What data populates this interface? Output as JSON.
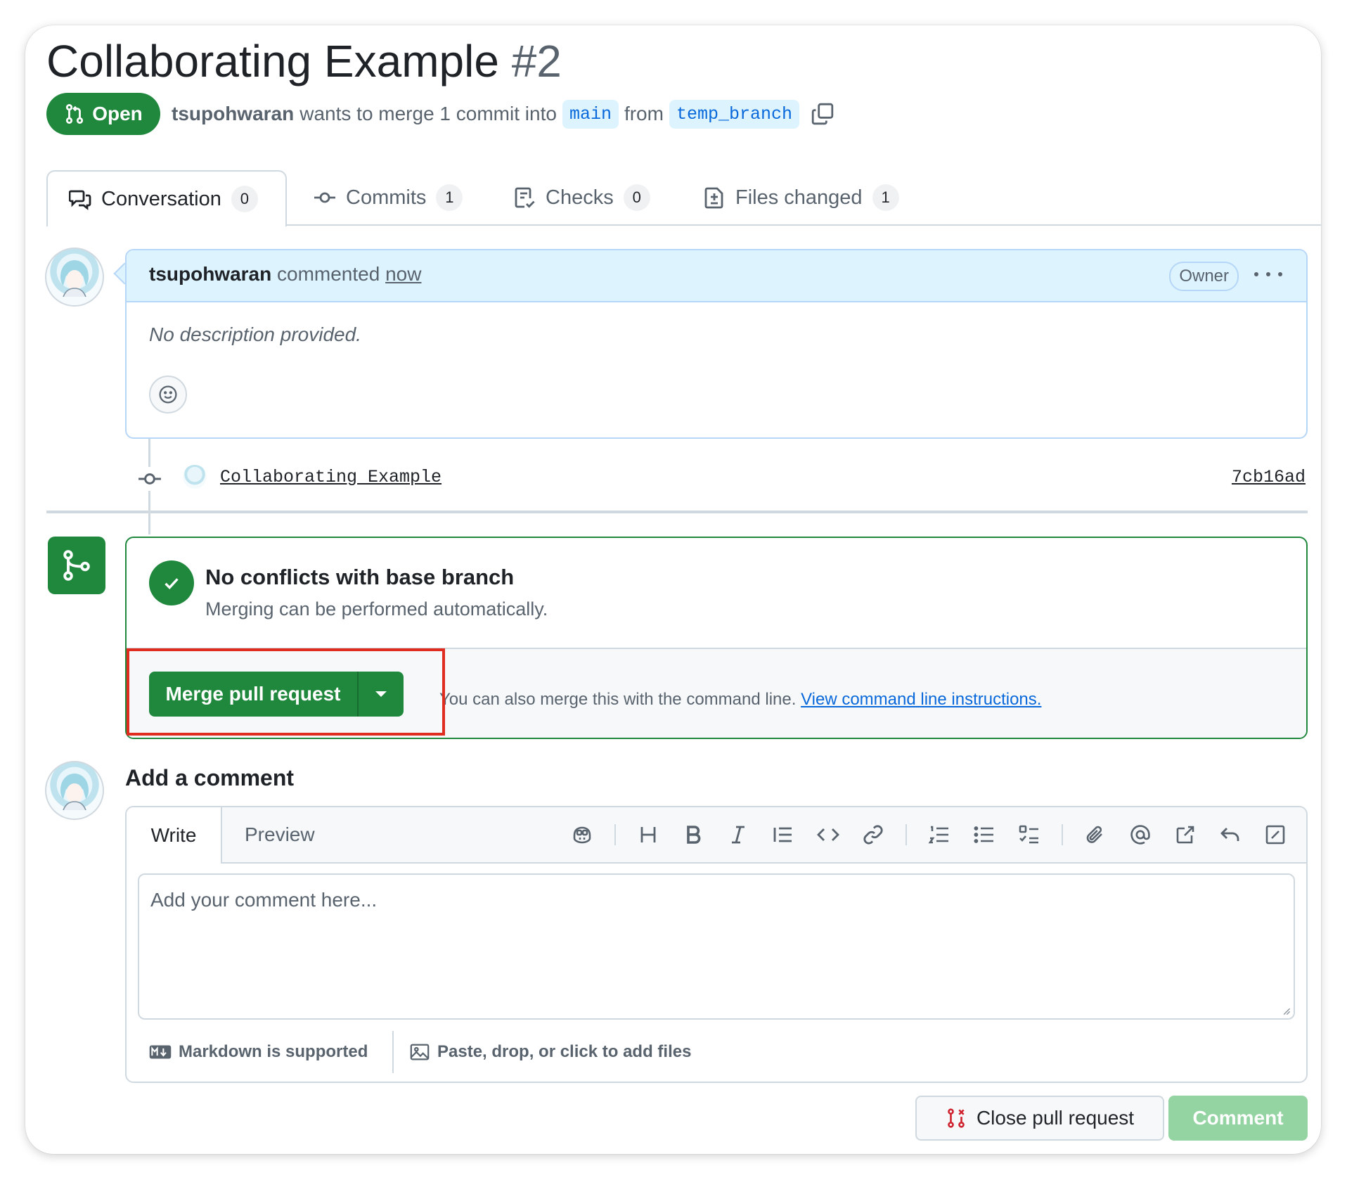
{
  "header": {
    "title": "Collaborating Example",
    "number": "#2",
    "status": "Open",
    "author": "tsupohwaran",
    "merge_text": "wants to merge 1 commit into",
    "base_branch": "main",
    "from_text": "from",
    "head_branch": "temp_branch"
  },
  "tabs": [
    {
      "label": "Conversation",
      "count": "0"
    },
    {
      "label": "Commits",
      "count": "1"
    },
    {
      "label": "Checks",
      "count": "0"
    },
    {
      "label": "Files changed",
      "count": "1"
    }
  ],
  "comment": {
    "author": "tsupohwaran",
    "verb": "commented",
    "time": "now",
    "badge": "Owner",
    "body": "No description provided."
  },
  "commit": {
    "message": "Collaborating Example",
    "sha": "7cb16ad"
  },
  "merge": {
    "title": "No conflicts with base branch",
    "subtitle": "Merging can be performed automatically.",
    "button": "Merge pull request",
    "cli_text": "You can also merge this with the command line.",
    "cli_link": "View command line instructions."
  },
  "add_comment": {
    "title": "Add a comment",
    "tab_write": "Write",
    "tab_preview": "Preview",
    "placeholder": "Add your comment here...",
    "markdown_note": "Markdown is supported",
    "files_note": "Paste, drop, or click to add files"
  },
  "actions": {
    "close": "Close pull request",
    "comment": "Comment"
  },
  "colors": {
    "success": "#1f883d",
    "link": "#0969da",
    "highlight": "#e02b1f"
  }
}
